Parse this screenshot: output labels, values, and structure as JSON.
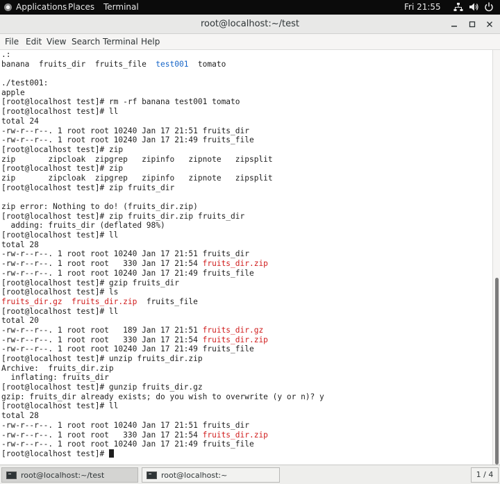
{
  "topbar": {
    "applications": "Applications",
    "places": "Places",
    "terminal": "Terminal",
    "clock": "Fri 21:55",
    "icons": [
      "network-icon",
      "volume-icon",
      "power-icon"
    ]
  },
  "window": {
    "title": "root@localhost:~/test",
    "controls": [
      "minimize",
      "maximize",
      "close"
    ]
  },
  "menubar": {
    "file": "File",
    "edit": "Edit",
    "view": "View",
    "search": "Search",
    "terminal": "Terminal",
    "help": "Help"
  },
  "colors": {
    "directory_blue": "#1565c8",
    "archive_red": "#d01c1c",
    "text": "#1e1e1e"
  },
  "terminal_lines": [
    [
      ".:"
    ],
    [
      [
        "banana  fruits_dir  fruits_file  ",
        ""
      ],
      [
        "test001",
        "blue"
      ],
      [
        "  tomato",
        ""
      ]
    ],
    [
      ""
    ],
    [
      "./test001:"
    ],
    [
      "apple"
    ],
    [
      "[root@localhost test]# rm -rf banana test001 tomato"
    ],
    [
      "[root@localhost test]# ll"
    ],
    [
      "total 24"
    ],
    [
      "-rw-r--r--. 1 root root 10240 Jan 17 21:51 fruits_dir"
    ],
    [
      "-rw-r--r--. 1 root root 10240 Jan 17 21:49 fruits_file"
    ],
    [
      "[root@localhost test]# zip"
    ],
    [
      "zip       zipcloak  zipgrep   zipinfo   zipnote   zipsplit"
    ],
    [
      "[root@localhost test]# zip"
    ],
    [
      "zip       zipcloak  zipgrep   zipinfo   zipnote   zipsplit"
    ],
    [
      "[root@localhost test]# zip fruits_dir"
    ],
    [
      ""
    ],
    [
      "zip error: Nothing to do! (fruits_dir.zip)"
    ],
    [
      "[root@localhost test]# zip fruits_dir.zip fruits_dir"
    ],
    [
      "  adding: fruits_dir (deflated 98%)"
    ],
    [
      "[root@localhost test]# ll"
    ],
    [
      "total 28"
    ],
    [
      "-rw-r--r--. 1 root root 10240 Jan 17 21:51 fruits_dir"
    ],
    [
      [
        "-rw-r--r--. 1 root root   330 Jan 17 21:54 ",
        ""
      ],
      [
        "fruits_dir.zip",
        "red"
      ]
    ],
    [
      "-rw-r--r--. 1 root root 10240 Jan 17 21:49 fruits_file"
    ],
    [
      "[root@localhost test]# gzip fruits_dir"
    ],
    [
      "[root@localhost test]# ls"
    ],
    [
      [
        "fruits_dir.gz",
        "red"
      ],
      [
        "  ",
        ""
      ],
      [
        "fruits_dir.zip",
        "red"
      ],
      [
        "  fruits_file",
        ""
      ]
    ],
    [
      "[root@localhost test]# ll"
    ],
    [
      "total 20"
    ],
    [
      [
        "-rw-r--r--. 1 root root   189 Jan 17 21:51 ",
        ""
      ],
      [
        "fruits_dir.gz",
        "red"
      ]
    ],
    [
      [
        "-rw-r--r--. 1 root root   330 Jan 17 21:54 ",
        ""
      ],
      [
        "fruits_dir.zip",
        "red"
      ]
    ],
    [
      "-rw-r--r--. 1 root root 10240 Jan 17 21:49 fruits_file"
    ],
    [
      "[root@localhost test]# unzip fruits_dir.zip"
    ],
    [
      "Archive:  fruits_dir.zip"
    ],
    [
      "  inflating: fruits_dir"
    ],
    [
      "[root@localhost test]# gunzip fruits_dir.gz"
    ],
    [
      "gzip: fruits_dir already exists; do you wish to overwrite (y or n)? y"
    ],
    [
      "[root@localhost test]# ll"
    ],
    [
      "total 28"
    ],
    [
      "-rw-r--r--. 1 root root 10240 Jan 17 21:51 fruits_dir"
    ],
    [
      [
        "-rw-r--r--. 1 root root   330 Jan 17 21:54 ",
        ""
      ],
      [
        "fruits_dir.zip",
        "red"
      ]
    ],
    [
      "-rw-r--r--. 1 root root 10240 Jan 17 21:49 fruits_file"
    ],
    [
      "[root@localhost test]# "
    ]
  ],
  "scrollbar": {
    "position_fraction": 0.55,
    "visible_fraction": 0.45
  },
  "taskbar": {
    "active_task": "root@localhost:~/test",
    "inactive_task": "root@localhost:~",
    "workspace": "1 / 4"
  }
}
